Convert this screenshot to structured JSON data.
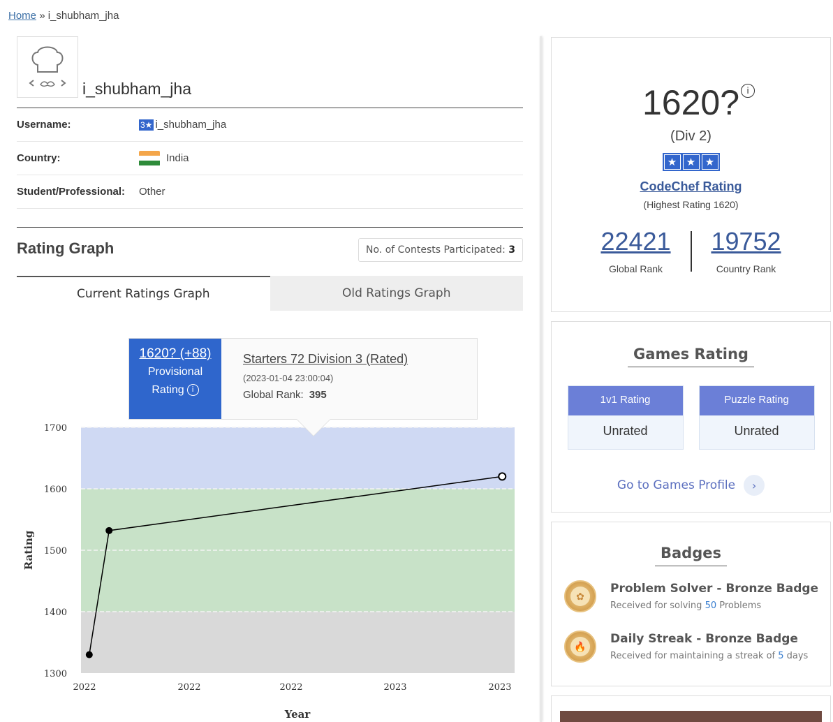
{
  "breadcrumb": {
    "home": "Home",
    "sep": "»",
    "current": "i_shubham_jha"
  },
  "profile": {
    "display_name": "i_shubham_jha",
    "username_label": "Username:",
    "username_stars": "3★",
    "username": "i_shubham_jha",
    "country_label": "Country:",
    "country": "India",
    "status_label": "Student/Professional:",
    "status": "Other"
  },
  "rating_graph": {
    "title": "Rating Graph",
    "contests_label": "No. of Contests Participated:",
    "contests_count": "3",
    "tabs": [
      "Current Ratings Graph",
      "Old Ratings Graph"
    ],
    "tooltip": {
      "rating": "1620? (+88)",
      "provisional_line1": "Provisional",
      "provisional_line2": "Rating",
      "contest": "Starters 72 Division 3 (Rated)",
      "date": "(2023-01-04 23:00:04)",
      "rank_label": "Global Rank:",
      "rank": "395"
    }
  },
  "chart_data": {
    "type": "line",
    "ylabel": "Rating",
    "xlabel": "Year",
    "ylim": [
      1300,
      1700
    ],
    "y_ticks": [
      1300,
      1400,
      1500,
      1600,
      1700
    ],
    "x_tick_labels": [
      "2022",
      "2022",
      "2022",
      "2023",
      "2023"
    ],
    "bands": [
      {
        "from": 1300,
        "to": 1400,
        "color": "#d9d9d9"
      },
      {
        "from": 1400,
        "to": 1600,
        "color": "#c8e2c8"
      },
      {
        "from": 1600,
        "to": 1700,
        "color": "#cfd9f3"
      }
    ],
    "points": [
      {
        "x": 0.0,
        "y": 1330
      },
      {
        "x": 0.048,
        "y": 1532
      },
      {
        "x": 1.0,
        "y": 1620
      }
    ],
    "x_range": [
      -0.02,
      1.03
    ],
    "line_color": "#000000"
  },
  "summary": {
    "rating": "1620?",
    "info": "i",
    "division": "(Div 2)",
    "stars": [
      "★",
      "★",
      "★"
    ],
    "codechef_label": "CodeChef Rating",
    "highest": "(Highest Rating 1620)",
    "global_rank": "22421",
    "global_rank_label": "Global Rank",
    "country_rank": "19752",
    "country_rank_label": "Country Rank"
  },
  "games": {
    "title": "Games Rating",
    "one_v_one_label": "1v1 Rating",
    "one_v_one_value": "Unrated",
    "puzzle_label": "Puzzle Rating",
    "puzzle_value": "Unrated",
    "profile_link": "Go to Games Profile",
    "chevron": "›"
  },
  "badges": {
    "title": "Badges",
    "items": [
      {
        "name": "Problem Solver - Bronze Badge",
        "desc_pre": "Received for solving ",
        "desc_num": "50",
        "desc_post": " Problems",
        "icon": "✿"
      },
      {
        "name": "Daily Streak - Bronze Badge",
        "desc_pre": "Received for maintaining a streak of ",
        "desc_num": "5",
        "desc_post": " days",
        "icon": "🔥"
      }
    ]
  }
}
